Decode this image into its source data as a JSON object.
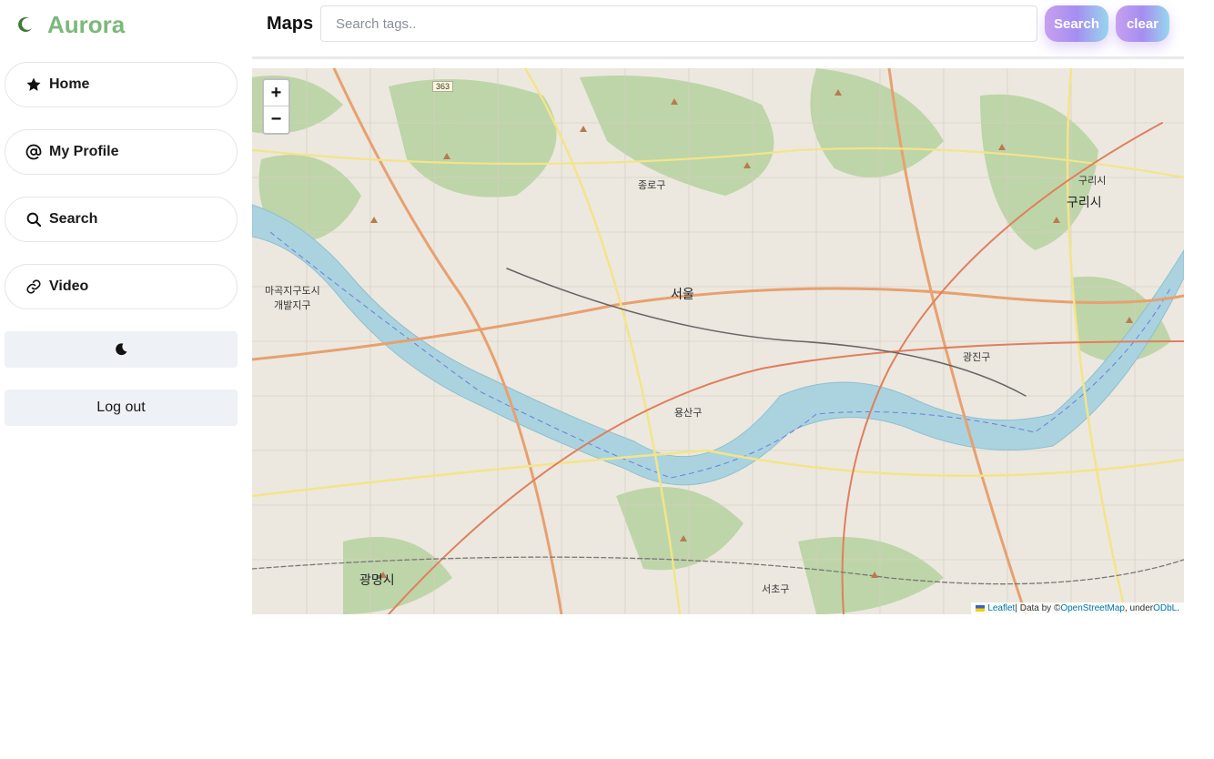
{
  "app": {
    "name": "Aurora"
  },
  "sidebar": {
    "items": [
      {
        "label": "Home",
        "icon": "star-icon"
      },
      {
        "label": "My Profile",
        "icon": "at-icon"
      },
      {
        "label": "Search",
        "icon": "search-icon"
      },
      {
        "label": "Video",
        "icon": "link-icon"
      }
    ],
    "theme_toggle_icon": "moon-icon",
    "logout_label": "Log out"
  },
  "header": {
    "title": "Maps",
    "search_placeholder": "Search tags..",
    "search_label": "Search",
    "clear_label": "clear"
  },
  "map": {
    "zoom_in": "+",
    "zoom_out": "−",
    "attribution": {
      "leaflet": "Leaflet",
      "data_by": " | Data by © ",
      "osm": "OpenStreetMap",
      "under": ", under ",
      "license": "ODbL",
      "end": "."
    },
    "labels": {
      "seoul": "서울",
      "guri": "구리시",
      "gwangmyeong": "광명시",
      "magok_1": "마곡지구도시",
      "magok_2": "개발지구",
      "yongsan": "용산구",
      "gwangjin": "광진구",
      "seocho": "서초구",
      "jongno": "종로구",
      "guri_small": "구리시",
      "road_363": "363"
    }
  },
  "colors": {
    "accent": "#7cb87a",
    "button_gradient_start": "#c79ff0",
    "button_gradient_end": "#98d6ee",
    "river": "#aad3df"
  }
}
